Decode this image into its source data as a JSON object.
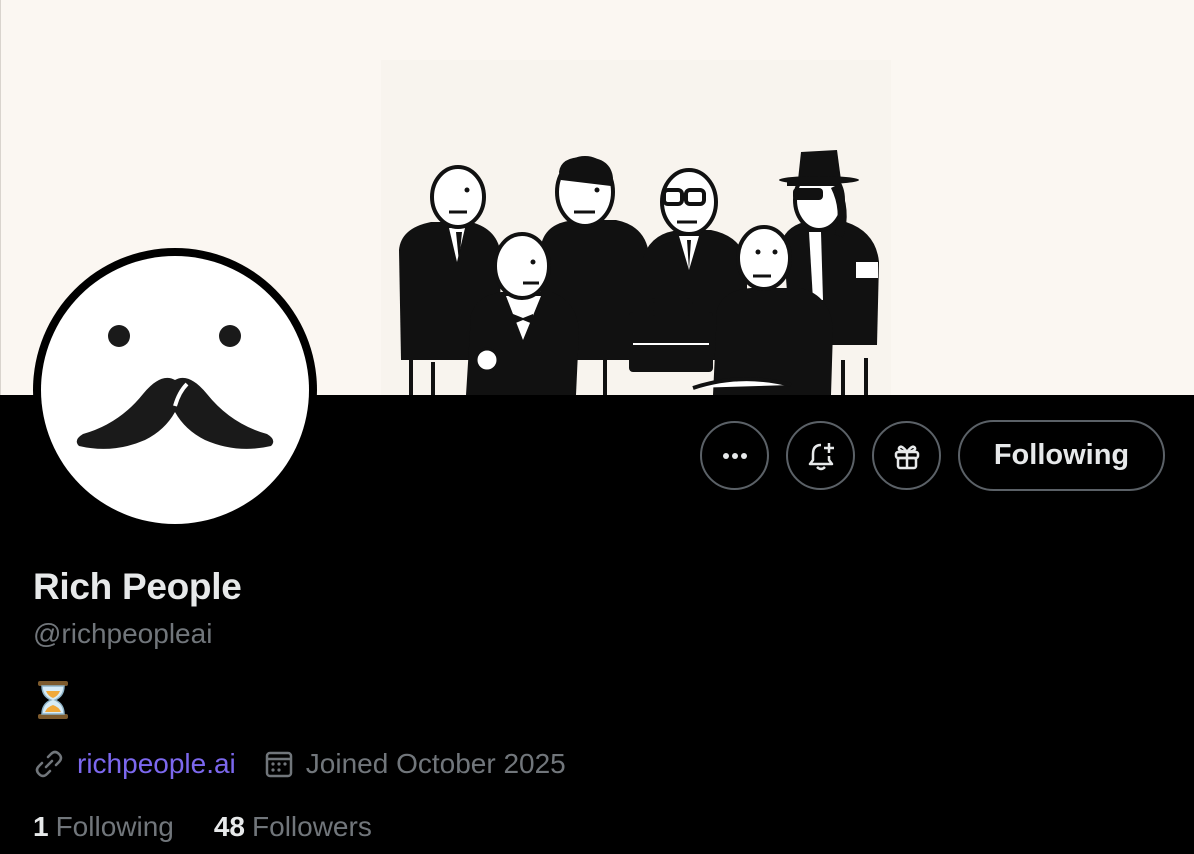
{
  "profile": {
    "name": "Rich People",
    "handle": "@richpeopleai",
    "bio_emoji": "hourglass-icon",
    "website": "richpeople.ai",
    "joined": "Joined October 2025"
  },
  "actions": {
    "more_icon": "more-horizontal-icon",
    "notify_icon": "bell-plus-icon",
    "gift_icon": "gift-icon",
    "follow_label": "Following"
  },
  "stats": {
    "following_count": "1",
    "following_label": "Following",
    "followers_count": "48",
    "followers_label": "Followers"
  },
  "colors": {
    "background": "#000000",
    "banner": "#fbf7f2",
    "primary_text": "#e7e9ea",
    "secondary_text": "#71767b",
    "link": "#7c68ee",
    "button_border": "#5b6167"
  }
}
